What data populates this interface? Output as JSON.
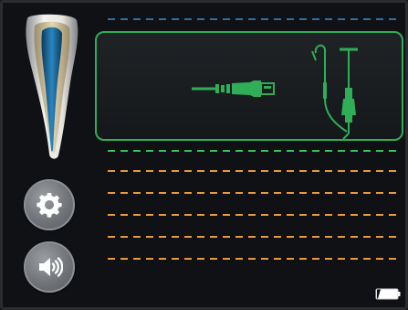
{
  "screen": {
    "background": "#0f1114",
    "accent": "#2fae57"
  },
  "tooth": {
    "icon": "tooth-root-canal-icon"
  },
  "buttons": {
    "settings": {
      "icon": "gear-icon"
    },
    "sound": {
      "icon": "speaker-volume-icon"
    }
  },
  "notice": {
    "icons": [
      "usb-cable-icon",
      "file-clip-and-lip-hook-icon"
    ],
    "border_color": "#2fae57"
  },
  "depth_scale": {
    "lines": [
      {
        "color": "#2f6fa3"
      },
      {
        "color": "#2f6fa3"
      },
      {
        "color": "#2f6fa3"
      },
      {
        "color": "#2f6fa3"
      },
      {
        "color": "#2f6fa3"
      },
      {
        "color": "#2f6fa3"
      },
      {
        "color": "#34c05a"
      },
      {
        "color": "#e89a3c"
      },
      {
        "color": "#e89a3c"
      },
      {
        "color": "#e89a3c"
      },
      {
        "color": "#e89a3c"
      },
      {
        "color": "#e89a3c"
      },
      {
        "color": "#d8362f"
      }
    ]
  },
  "battery": {
    "icon": "battery-low-icon"
  }
}
